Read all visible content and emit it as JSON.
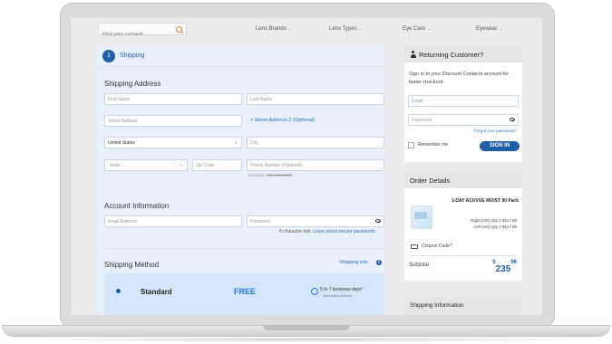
{
  "nav": {
    "search_placeholder": "Find your contacts",
    "items": [
      {
        "label": "Lens Brands"
      },
      {
        "label": "Lens Types"
      },
      {
        "label": "Eye Care"
      },
      {
        "label": "Eyewear"
      }
    ]
  },
  "checkout": {
    "step_number": "1",
    "step_title": "Shipping",
    "shipping_address": {
      "title": "Shipping Address",
      "first_name_placeholder": "First Name",
      "last_name_placeholder": "Last Name",
      "street_placeholder": "Street Address",
      "street2_link": "+ Street Address 2 (Optional)",
      "country_value": "United States",
      "city_placeholder": "City",
      "state_placeholder": "-State-",
      "zip_placeholder": "Zip Code",
      "phone_placeholder": "Phone Number (Optional)",
      "phone_example_label": "Example:",
      "phone_example_value": "555-555-5555"
    },
    "account": {
      "title": "Account Information",
      "email_placeholder": "Email Address",
      "password_placeholder": "Password",
      "password_hint": "8 character min.",
      "learn_link": "Learn about secure passwords"
    },
    "shipping_method": {
      "title": "Shipping Method",
      "info_link": "Shipping info",
      "option_name": "Standard",
      "option_price": "FREE",
      "option_days": "5 to 7 business days*",
      "option_note": "estimated delivery"
    }
  },
  "sidebar": {
    "returning": {
      "title": "Returning Customer?",
      "description": "Sign in to your Discount Contacts account for faster checkout.",
      "email_placeholder": "Email",
      "password_placeholder": "Password",
      "forgot_link": "Forgot your password?",
      "remember_label": "Remember me",
      "signin_button": "SIGN IN"
    },
    "order": {
      "title": "Order Details",
      "product_name": "1-DAY ACUVUE MOIST 90 Pack",
      "right_line": "Right (OD) Qty 2 $117.98",
      "left_line": "Left (OS) Qty 2 $117.98",
      "coupon_label": "Coupon Code?",
      "subtotal_label": "Subtotal",
      "subtotal_currency": "$",
      "subtotal_whole": "235",
      "subtotal_cents": "96"
    },
    "shipping_info_title": "Shipping Information"
  }
}
